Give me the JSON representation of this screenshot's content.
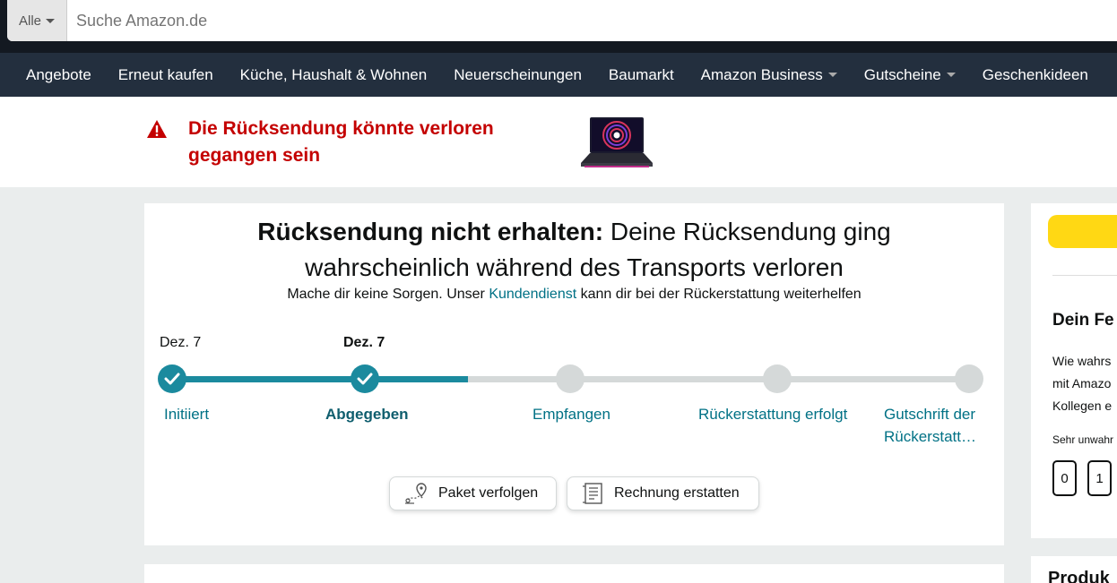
{
  "search": {
    "category": "Alle",
    "placeholder": "Suche Amazon.de"
  },
  "nav": {
    "items": [
      {
        "label": "Angebote",
        "dropdown": false
      },
      {
        "label": "Erneut kaufen",
        "dropdown": false
      },
      {
        "label": "Küche, Haushalt & Wohnen",
        "dropdown": false
      },
      {
        "label": "Neuerscheinungen",
        "dropdown": false
      },
      {
        "label": "Baumarkt",
        "dropdown": false
      },
      {
        "label": "Amazon Business",
        "dropdown": true
      },
      {
        "label": "Gutscheine",
        "dropdown": true
      },
      {
        "label": "Geschenkideen",
        "dropdown": false
      }
    ]
  },
  "alert": {
    "line1": "Die Rücksendung könnte verloren",
    "line2": "gegangen sein",
    "icon": "warning-icon"
  },
  "status": {
    "title_bold": "Rücksendung nicht erhalten:",
    "title_rest_line1": " Deine Rücksendung ging",
    "title_line2": "wahrscheinlich während des Transports verloren",
    "sub_before": "Mache dir keine Sorgen. Unser ",
    "sub_link": "Kundendienst",
    "sub_after": " kann dir bei der Rückerstattung weiterhelfen"
  },
  "progress": {
    "completed_steps": 2,
    "steps": [
      {
        "label": "Initiiert",
        "date": "Dez. 7",
        "done": true,
        "active": false
      },
      {
        "label": "Abgegeben",
        "date": "Dez. 7",
        "done": true,
        "active": true
      },
      {
        "label": "Empfangen",
        "date": "",
        "done": false,
        "active": false
      },
      {
        "label": "Rückerstattung erfolgt",
        "date": "",
        "done": false,
        "active": false
      },
      {
        "label_line1": "Gutschrift der",
        "label_line2": "Rückerstatt…",
        "date": "",
        "done": false,
        "active": false
      }
    ]
  },
  "buttons": {
    "track": "Paket verfolgen",
    "refund": "Rechnung erstatten"
  },
  "right": {
    "heading": "Dein Fe",
    "text_line1": "Wie wahrs",
    "text_line2": "mit Amazo",
    "text_line3": "Kollegen e",
    "small": "Sehr unwahr",
    "score0": "0",
    "score1": "1",
    "heading2": "Produk"
  },
  "colors": {
    "accent": "#1b8a9e",
    "alert": "#c40000",
    "link": "#007185",
    "nav_bg": "#232f3e",
    "cta": "#ffd814"
  }
}
